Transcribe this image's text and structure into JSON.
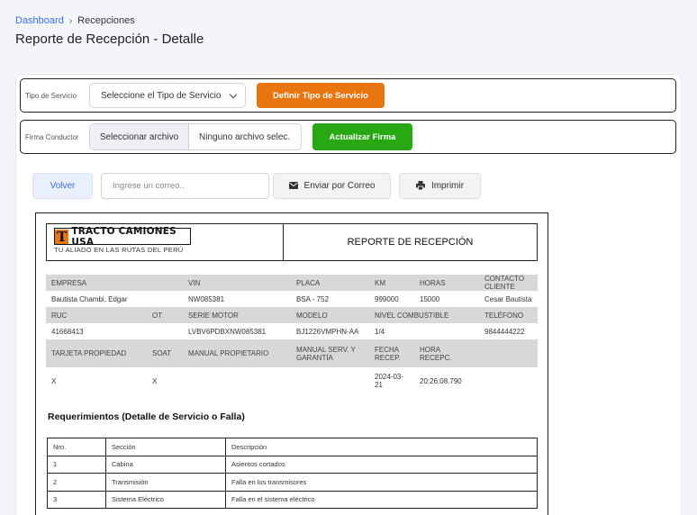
{
  "breadcrumb": {
    "link": "Dashboard",
    "separator": "›",
    "current": "Recepciones"
  },
  "page_title": "Reporte de Recepción - Detalle",
  "form": {
    "servicio_label": "Tipo de Servicio",
    "servicio_select": "Seleccione el Tipo de Servicio",
    "servicio_button": "Definir Tipo de Servicio",
    "firma_label": "Firma Conductor",
    "file_button": "Seleccionar archivo",
    "file_name": "Ninguno archivo selec.",
    "firma_button": "Actualizar Firma"
  },
  "actions": {
    "volver": "Volver",
    "email_placeholder": "Ingrese un correo..",
    "enviar": "Enviar por Correo",
    "imprimir": "Imprimir"
  },
  "colors": {
    "accent_orange": "#e8750f",
    "accent_green": "#28a914",
    "link_blue": "#3b6fe0"
  },
  "report": {
    "logo_text": "TRACTO CAMIONES USA",
    "logo_letter": "T",
    "logo_tagline": "TU ALIADO EN LAS RUTAS DEL PERÚ",
    "title": "REPORTE DE RECEPCIÓN",
    "row1_head": [
      "EMPRESA",
      "VIN",
      "PLACA",
      "KM",
      "HORAS",
      "CONTACTO CLIENTE"
    ],
    "row1_vals": [
      "Bautista Chambi, Edgar",
      "NW085381",
      "BSA - 752",
      "999000",
      "15000",
      "Cesar Bautista"
    ],
    "row2_head": [
      "RUC",
      "OT",
      "SERIE MOTOR",
      "MODELO",
      "NIVEL COMBUSTIBLE",
      "TELÉFONO"
    ],
    "row2_vals": [
      "41668413",
      "",
      "LVBV6PDBXNW085381",
      "BJ1226VMPHN-AA",
      "1/4",
      "9844444222"
    ],
    "row3_head": [
      "TARJETA PROPIEDAD",
      "SOAT",
      "MANUAL PROPIETARIO",
      "MANUAL SERV. Y GARANTÍA",
      "FECHA RECEP.",
      "HORA RECEPC."
    ],
    "row3_vals": [
      "X",
      "X",
      "",
      "",
      "2024-03-21",
      "20:26:08.790"
    ],
    "req_title": "Requerimientos (Detalle de Servicio o Falla)",
    "req_headers": [
      "Nro.",
      "Sección",
      "Descripción"
    ],
    "req_rows": [
      [
        "1",
        "Cabina",
        "Asientos cortados"
      ],
      [
        "2",
        "Transmisión",
        "Falla en los transmisores"
      ],
      [
        "3",
        "Sistema Eléctrico",
        "Falla en el sistema eléctrico"
      ]
    ]
  }
}
